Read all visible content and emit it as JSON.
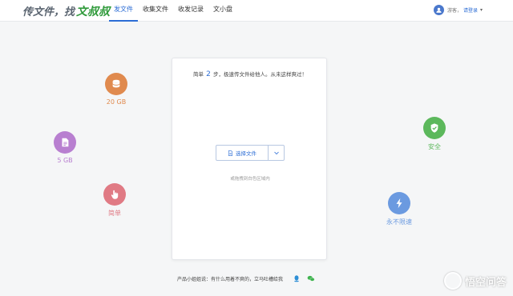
{
  "header": {
    "logo_prefix": "传文件，找",
    "logo_brand": "文叔叔",
    "nav": [
      "发文件",
      "收集文件",
      "收发记录",
      "文小盘"
    ],
    "user_prefix": "游客，",
    "login_label": "请登录",
    "caret": "▾"
  },
  "features": {
    "storage20": {
      "label": "20 GB",
      "color": "#e08a4e"
    },
    "storage5": {
      "label": "5 GB",
      "color": "#b87fd0"
    },
    "simple": {
      "label": "简单",
      "color": "#e07a84"
    },
    "secure": {
      "label": "安全",
      "color": "#5cb85c"
    },
    "speed": {
      "label": "永不限速",
      "color": "#6b9ae0"
    }
  },
  "card": {
    "title_before": "简单",
    "title_num": "2",
    "title_after": "步，极速传文件给他人。从未这样爽过！",
    "select_label": "选择文件",
    "drop_hint": "或拖拽到白色区域内"
  },
  "footer": {
    "text": "产品小姐姐说：有什么用着不爽的，立马吐槽给我"
  },
  "watermark": {
    "text": "悟空问答"
  }
}
